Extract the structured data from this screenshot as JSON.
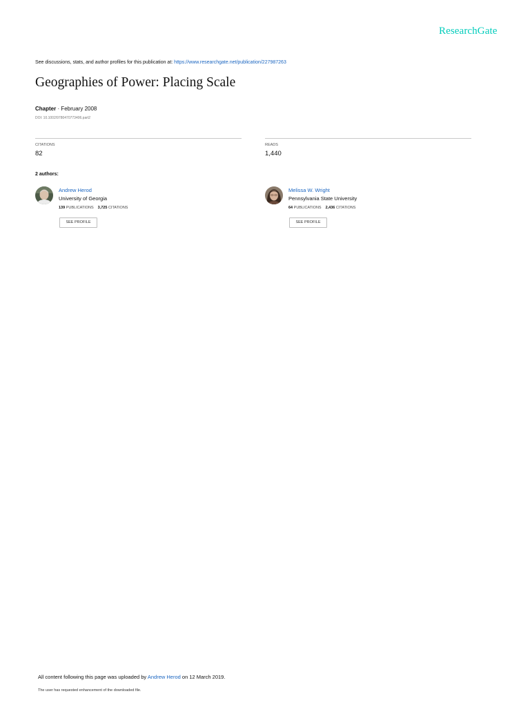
{
  "brand": {
    "logo_text": "ResearchGate",
    "accent_color": "#00ccbb",
    "link_color": "#1a65c0"
  },
  "header": {
    "lead_text": "See discussions, stats, and author profiles for this publication at: ",
    "publication_url": "https://www.researchgate.net/publication/227987263"
  },
  "publication": {
    "title": "Geographies of Power: Placing Scale",
    "type": "Chapter",
    "separator": " · ",
    "date": "February 2008",
    "doi": "DOI: 10.1002/9780470773406.part2"
  },
  "stats": {
    "citations_label": "CITATIONS",
    "citations_value": "82",
    "reads_label": "READS",
    "reads_value": "1,440"
  },
  "authors_heading": "2 authors:",
  "authors": [
    {
      "name": "Andrew Herod",
      "institution": "University of Georgia",
      "publications_count": "139",
      "publications_label": "PUBLICATIONS",
      "citations_count": "3,725",
      "citations_label": "CITATIONS",
      "button_label": "SEE PROFILE"
    },
    {
      "name": "Melissa W. Wright",
      "institution": "Pennsylvania State University",
      "publications_count": "64",
      "publications_label": "PUBLICATIONS",
      "citations_count": "2,436",
      "citations_label": "CITATIONS",
      "button_label": "SEE PROFILE"
    }
  ],
  "footer": {
    "upload_prefix": "All content following this page was uploaded by ",
    "uploader": "Andrew Herod",
    "upload_suffix": " on 12 March 2019.",
    "enhancement_note": "The user has requested enhancement of the downloaded file."
  }
}
